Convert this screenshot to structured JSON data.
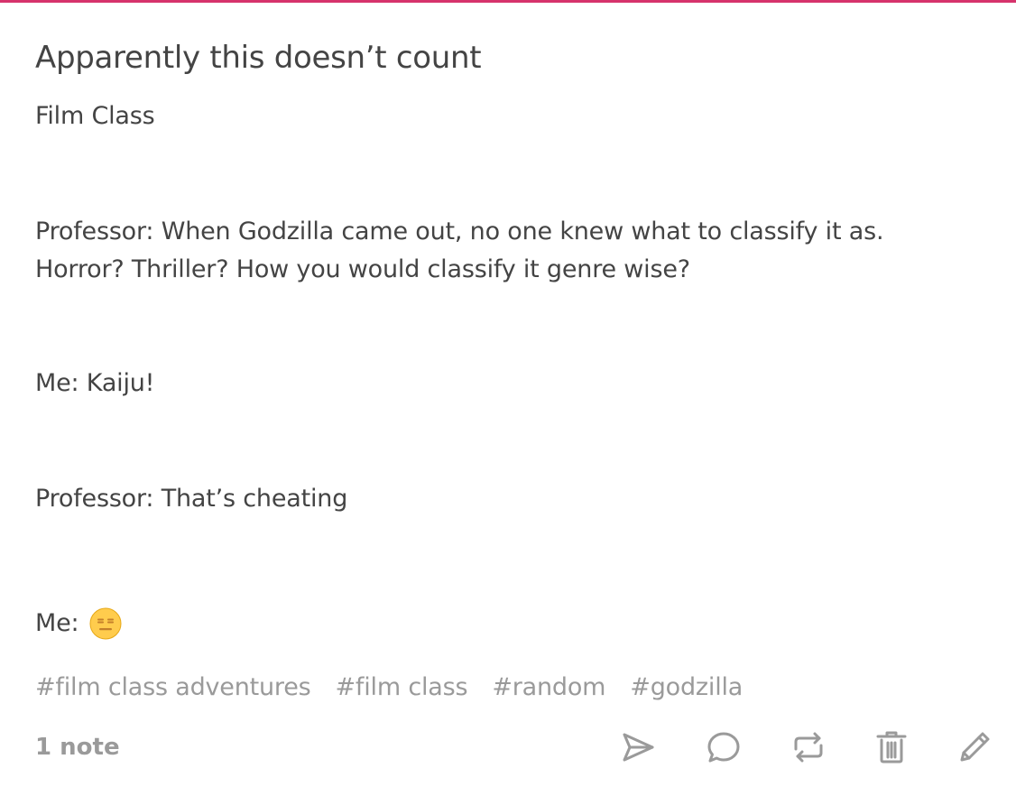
{
  "post": {
    "title": "Apparently this doesn’t count",
    "body": [
      "Film Class",
      "Professor: When Godzilla came out, no one knew what to classify it as.",
      "Horror? Thriller? How you would classify it genre wise?",
      "Me: Kaiju!",
      "Professor: That’s cheating",
      "Me:"
    ],
    "emoji": "expressionless-face-emoji",
    "tags": [
      "#film class adventures",
      "#film class",
      "#random",
      "#godzilla"
    ],
    "notes": "1 note"
  },
  "actions": {
    "icons": [
      "send-icon",
      "reply-icon",
      "reblog-icon",
      "delete-icon",
      "edit-icon"
    ]
  },
  "colors": {
    "accent": "#d6336c",
    "text": "#444444",
    "muted": "#9a9a9a",
    "emoji_fill": "#ffcc4d"
  }
}
